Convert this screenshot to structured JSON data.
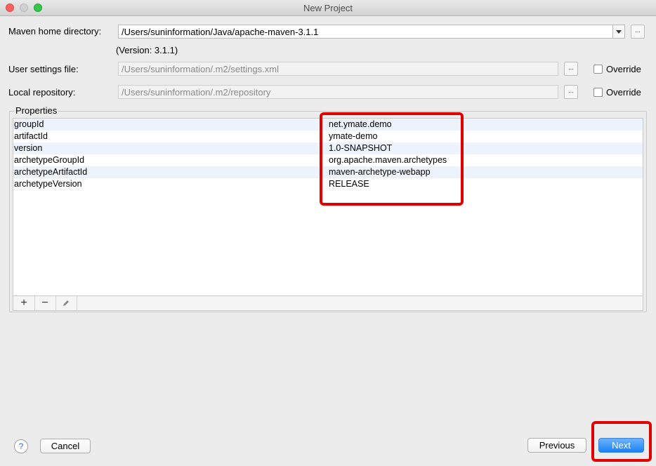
{
  "window": {
    "title": "New Project"
  },
  "maven": {
    "home_label": "Maven home directory:",
    "home_value": "/Users/suninformation/Java/apache-maven-3.1.1",
    "version_text": "(Version: 3.1.1)",
    "browse_label": "...",
    "settings_label": "User settings file:",
    "settings_value": "/Users/suninformation/.m2/settings.xml",
    "repo_label": "Local repository:",
    "repo_value": "/Users/suninformation/.m2/repository",
    "override_label": "Override"
  },
  "properties": {
    "legend": "Properties",
    "rows": [
      {
        "key": "groupId",
        "value": "net.ymate.demo"
      },
      {
        "key": "artifactId",
        "value": "ymate-demo"
      },
      {
        "key": "version",
        "value": "1.0-SNAPSHOT"
      },
      {
        "key": "archetypeGroupId",
        "value": "org.apache.maven.archetypes"
      },
      {
        "key": "archetypeArtifactId",
        "value": "maven-archetype-webapp"
      },
      {
        "key": "archetypeVersion",
        "value": "RELEASE"
      }
    ],
    "toolbar": {
      "add": "+",
      "remove": "−"
    }
  },
  "footer": {
    "help": "?",
    "cancel": "Cancel",
    "previous": "Previous",
    "next": "Next"
  },
  "colors": {
    "highlight": "#e00000",
    "primary": "#1a82fb",
    "row_stripe": "#edf3fc"
  },
  "icons": [
    "close-dot-icon",
    "minimize-dot-icon",
    "maximize-dot-icon",
    "dropdown-arrow-icon",
    "pencil-icon",
    "help-icon"
  ]
}
